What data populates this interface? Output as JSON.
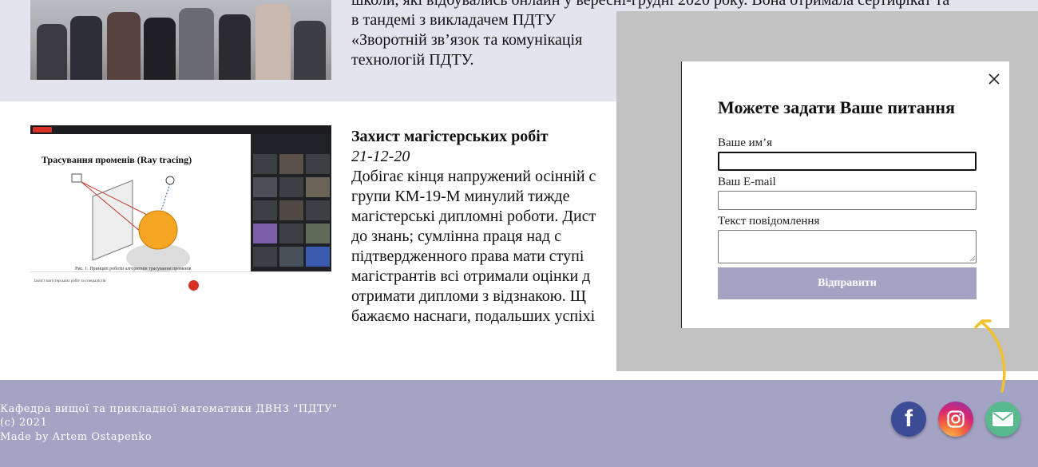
{
  "news_top": {
    "lines": [
      "школи, які відбувались онлайн у вересні-грудні 2020 року. Вона отримала сертифікат та",
      "в тандемі з викладачем ПДТУ",
      "«Зворотній зв’язок та комунікація",
      "технологій ПДТУ."
    ]
  },
  "news_item": {
    "title": "Захист магістерських робіт",
    "date": "21-12-20",
    "lines": [
      "Добігає кінця напружений осінній с",
      "групи КМ-19-М минулий тижде",
      "магістерські дипломні роботи. Дист",
      "до знань; сумлінна праця над с",
      "підтвердженного права мати ступі",
      "магістрантів всі отримали оцінки д",
      "отримати дипломи з відзнакою. Щ",
      "бажаємо наснаги, подальших успіхі"
    ],
    "screenshot": {
      "slide_title": "Трасування променів (Ray tracing)",
      "slide_caption": "Рис. 1. Принцип роботи алгоритмів трасування променів",
      "bar_label": "Захист магістерських робіт та спеціалістів"
    }
  },
  "footer": {
    "line1": "Кафедра вищої та прикладної математики ДВНЗ \"ПДТУ\"",
    "line2": "(с) 2021",
    "line3": "Made by Artem Ostapenko"
  },
  "social": {
    "facebook_label": "f",
    "icons": [
      "facebook-icon",
      "instagram-icon",
      "mail-icon"
    ]
  },
  "modal": {
    "title": "Можете задати Ваше питання",
    "name_label": "Ваше им’я",
    "name_value": "",
    "email_label": "Ваш E-mail",
    "email_value": "",
    "message_label": "Текст повідомлення",
    "message_value": "",
    "submit_label": "Відправити"
  },
  "colors": {
    "accent": "#a3a3c4",
    "band": "#e4e4ee",
    "overlay": "#c2c2c2",
    "arrow": "#f2c12e"
  }
}
